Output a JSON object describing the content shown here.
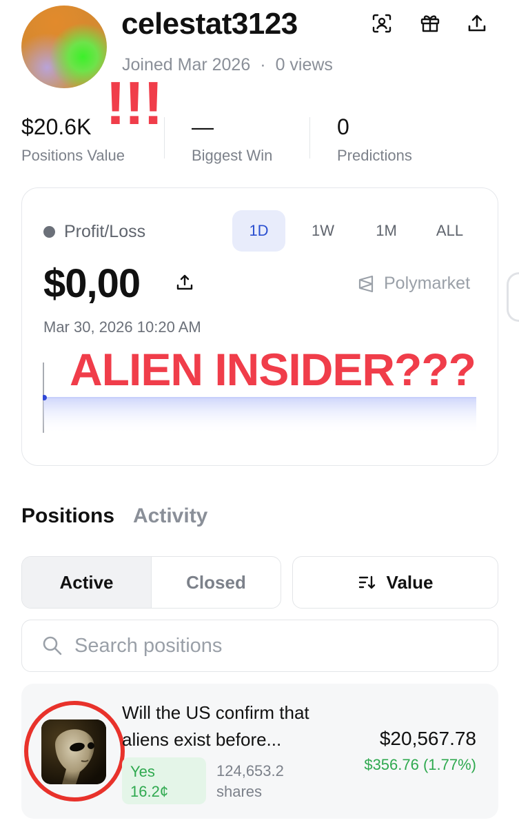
{
  "profile": {
    "username": "celestat3123",
    "joined": "Joined Mar 2026",
    "separator": "·",
    "views": "0 views"
  },
  "header_icons": [
    "face-scan-icon",
    "gift-icon",
    "share-icon"
  ],
  "overlay": {
    "exclamation": "!!!",
    "headline": "ALIEN INSIDER???"
  },
  "stats": [
    {
      "value": "$20.6K",
      "label": "Positions Value"
    },
    {
      "value": "—",
      "label": "Biggest Win"
    },
    {
      "value": "0",
      "label": "Predictions"
    }
  ],
  "pnl": {
    "label": "Profit/Loss",
    "ranges": [
      "1D",
      "1W",
      "1M",
      "ALL"
    ],
    "selected_range": "1D",
    "value": "$0,00",
    "date": "Mar 30, 2026 10:20 AM",
    "brand": "Polymarket"
  },
  "tabs": {
    "positions": "Positions",
    "activity": "Activity",
    "selected": "Positions"
  },
  "filters": {
    "active": "Active",
    "closed": "Closed",
    "selected": "Active",
    "sort_label": "Value"
  },
  "search": {
    "placeholder": "Search positions",
    "value": ""
  },
  "positions": [
    {
      "title": "Will the US confirm that aliens exist before...",
      "outcome": "Yes",
      "price": "16.2¢",
      "shares_count": "124,653.2",
      "shares_unit": "shares",
      "value": "$20,567.78",
      "pnl": "$356.76 (1.77%)"
    }
  ],
  "colors": {
    "accent_blue": "#2a4fd0",
    "positive_green": "#2fa94f",
    "overlay_red": "#f03d4a",
    "highlight_ring": "#e8322b"
  }
}
